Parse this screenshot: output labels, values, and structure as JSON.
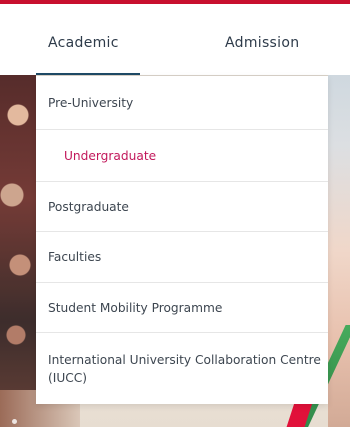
{
  "nav": {
    "academic_label": "Academic",
    "admission_label": "Admission"
  },
  "dropdown": {
    "items": [
      {
        "label": "Pre-University",
        "active": false
      },
      {
        "label": "Undergraduate",
        "active": true
      },
      {
        "label": "Postgraduate",
        "active": false
      },
      {
        "label": "Faculties",
        "active": false
      },
      {
        "label": "Student Mobility Programme",
        "active": false
      },
      {
        "label": "International University Collaboration Centre (IUCC)",
        "active": false
      }
    ]
  },
  "colors": {
    "brand_red": "#c8102e",
    "active_item": "#c2185b",
    "nav_text": "#2e3b4a",
    "nav_underline": "#1f4a66"
  }
}
